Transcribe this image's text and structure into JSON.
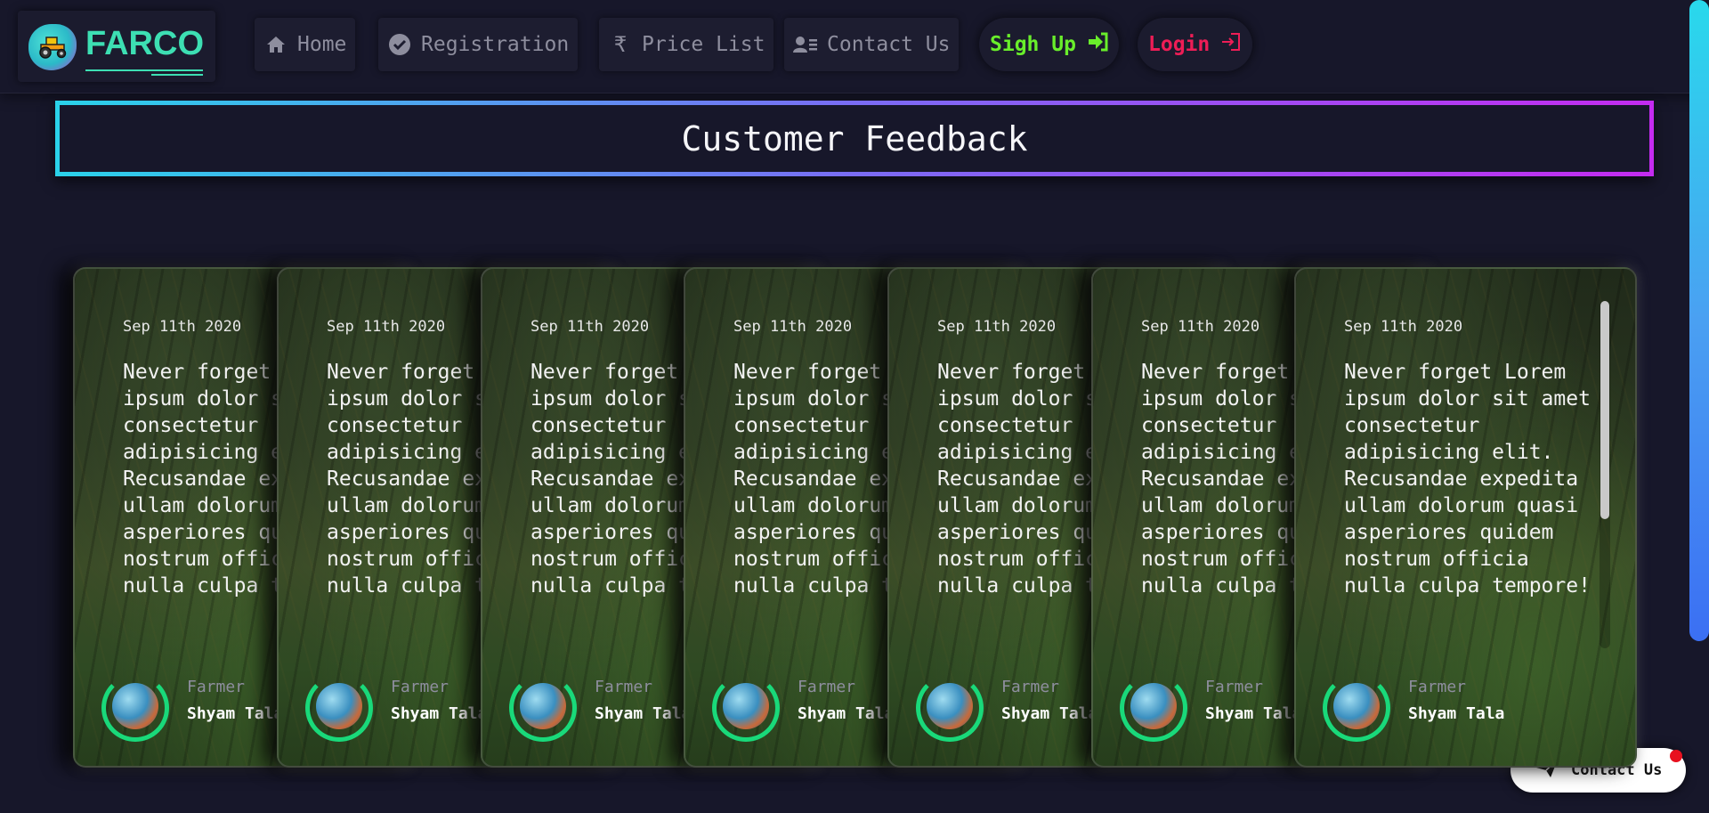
{
  "brand": {
    "name": "FARCO",
    "logo_icon": "tractor-icon"
  },
  "nav": {
    "home": {
      "label": "Home",
      "icon": "home-icon"
    },
    "registration": {
      "label": "Registration",
      "icon": "check-circle-icon"
    },
    "price_list": {
      "label": "Price List",
      "icon": "rupee-icon"
    },
    "contact": {
      "label": "Contact Us",
      "icon": "contact-card-icon"
    },
    "signup": {
      "label": "Sigh Up",
      "icon": "sign-in-icon",
      "color": "#69ee2b"
    },
    "login": {
      "label": "Login",
      "icon": "login-icon",
      "color": "#ee1d56"
    }
  },
  "section_title": "Customer Feedback",
  "cards": [
    {
      "date": "Sep 11th 2020",
      "quote": "Never forget Lorem ipsum dolor sit amet consectetur adipisicing elit. Recusandae expedita ullam dolorum quasi asperiores quidem nostrum officia nulla culpa tempore! Lorem",
      "role": "Farmer",
      "name": "Shyam Tala"
    },
    {
      "date": "Sep 11th 2020",
      "quote": "Never forget Lorem ipsum dolor sit amet consectetur adipisicing elit. Recusandae expedita ullam dolorum quasi asperiores quidem nostrum officia nulla culpa tempore! Lorem",
      "role": "Farmer",
      "name": "Shyam Tala"
    },
    {
      "date": "Sep 11th 2020",
      "quote": "Never forget Lorem ipsum dolor sit amet consectetur adipisicing elit. Recusandae expedita ullam dolorum quasi asperiores quidem nostrum officia nulla culpa tempore! Lorem",
      "role": "Farmer",
      "name": "Shyam Tala"
    },
    {
      "date": "Sep 11th 2020",
      "quote": "Never forget Lorem ipsum dolor sit amet consectetur adipisicing elit. Recusandae expedita ullam dolorum quasi asperiores quidem nostrum officia nulla culpa tempore! Lorem",
      "role": "Farmer",
      "name": "Shyam Tala"
    },
    {
      "date": "Sep 11th 2020",
      "quote": "Never forget Lorem ipsum dolor sit amet consectetur adipisicing elit. Recusandae expedita ullam dolorum quasi asperiores quidem nostrum officia nulla culpa tempore! Lorem",
      "role": "Farmer",
      "name": "Shyam Tala"
    },
    {
      "date": "Sep 11th 2020",
      "quote": "Never forget Lorem ipsum dolor sit amet consectetur adipisicing elit. Recusandae expedita ullam dolorum quasi asperiores quidem nostrum officia nulla culpa tempore! Lorem",
      "role": "Farmer",
      "name": "Shyam Tala"
    },
    {
      "date": "Sep 11th 2020",
      "quote": "Never forget Lorem ipsum dolor sit amet consectetur adipisicing elit. Recusandae expedita ullam dolorum quasi asperiores quidem nostrum officia nulla culpa tempore! Lorem",
      "role": "Farmer",
      "name": "Shyam Tala"
    }
  ],
  "contact_float": {
    "label": "Contact Us",
    "icon": "paper-plane-icon"
  },
  "colors": {
    "accent_green": "#19d97a",
    "gradient_start": "#2ad2ea",
    "gradient_end": "#c42bf0"
  }
}
